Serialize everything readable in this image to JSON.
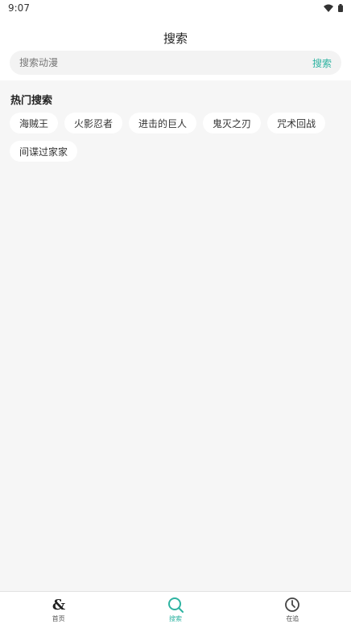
{
  "status_bar": {
    "time": "9:07"
  },
  "header": {
    "title": "搜索"
  },
  "search": {
    "placeholder": "搜索动漫",
    "button_label": "搜索"
  },
  "hot_search": {
    "title": "热门搜索",
    "tags": [
      "海贼王",
      "火影忍者",
      "进击的巨人",
      "鬼灭之刃",
      "咒术回战",
      "间谍过家家"
    ]
  },
  "bottom_nav": {
    "items": [
      {
        "label": "首页",
        "icon": "home-icon"
      },
      {
        "label": "搜索",
        "icon": "search-icon"
      },
      {
        "label": "在追",
        "icon": "clock-icon"
      }
    ],
    "active_index": 1
  },
  "colors": {
    "accent": "#2eb3a1",
    "background": "#f6f6f6"
  }
}
